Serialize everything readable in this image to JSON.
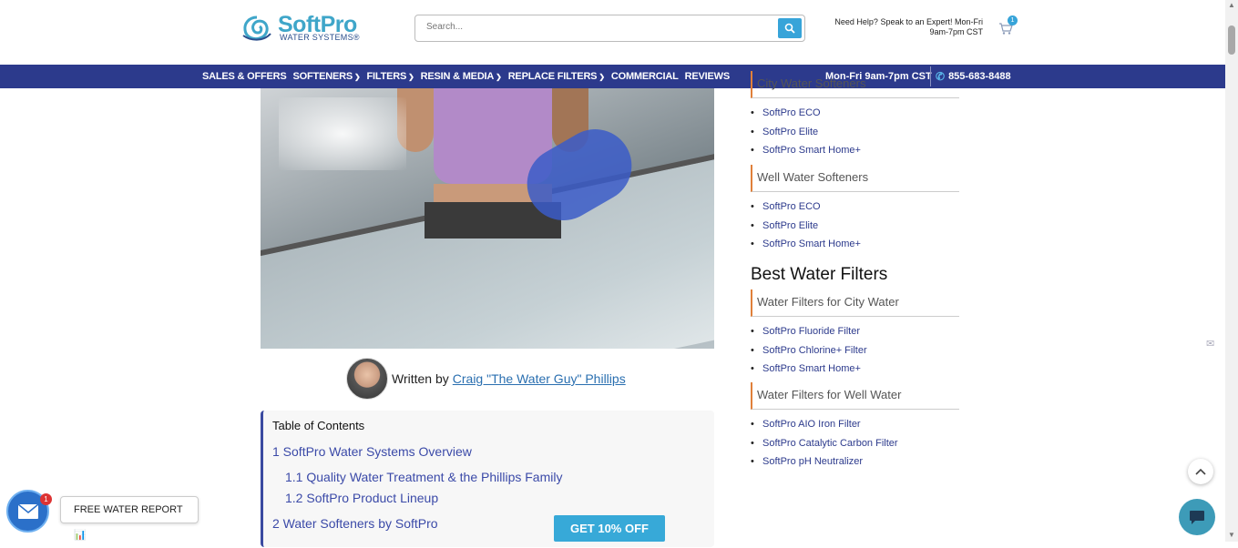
{
  "header": {
    "logo_text": "SoftPro",
    "logo_sub": "WATER SYSTEMS",
    "logo_reg": "®",
    "search_placeholder": "Search...",
    "help_text": "Need Help? Speak to an Expert! Mon-Fri 9am-7pm CST",
    "cart_count": "1"
  },
  "nav": {
    "items": [
      {
        "label": "SALES & OFFERS",
        "dropdown": false
      },
      {
        "label": "SOFTENERS",
        "dropdown": true
      },
      {
        "label": "FILTERS",
        "dropdown": true
      },
      {
        "label": "RESIN & MEDIA",
        "dropdown": true
      },
      {
        "label": "REPLACE FILTERS",
        "dropdown": true
      },
      {
        "label": "COMMERCIAL",
        "dropdown": false
      },
      {
        "label": "REVIEWS",
        "dropdown": false
      }
    ],
    "hours": "Mon-Fri 9am-7pm CST",
    "phone": "855-683-8488"
  },
  "author": {
    "prefix": "Written by",
    "name": "Craig \"The Water Guy\" Phillips"
  },
  "toc": {
    "title": "Table of Contents",
    "items": [
      "1 SoftPro Water Systems Overview",
      "1.1 Quality Water Treatment & the Phillips Family",
      "1.2 SoftPro Product Lineup",
      "2 Water Softeners by SoftPro"
    ]
  },
  "cta": "GET 10% OFF",
  "sidebar": {
    "partial_head": "City Water Softeners",
    "city_softeners": [
      "SoftPro ECO",
      "SoftPro Elite",
      "SoftPro Smart Home+"
    ],
    "well_head": "Well Water Softeners",
    "well_softeners": [
      "SoftPro ECO",
      "SoftPro Elite",
      "SoftPro Smart Home+"
    ],
    "filters_title": "Best Water Filters",
    "city_filters_head": "Water Filters for City Water",
    "city_filters": [
      "SoftPro Fluoride Filter",
      "SoftPro Chlorine+ Filter",
      "SoftPro Smart Home+"
    ],
    "well_filters_head": "Water Filters for Well Water",
    "well_filters": [
      "SoftPro AIO Iron Filter",
      "SoftPro Catalytic Carbon Filter",
      "SoftPro pH Neutralizer"
    ]
  },
  "floaters": {
    "report_label": "FREE WATER REPORT 📊",
    "mail_badge": "1"
  }
}
